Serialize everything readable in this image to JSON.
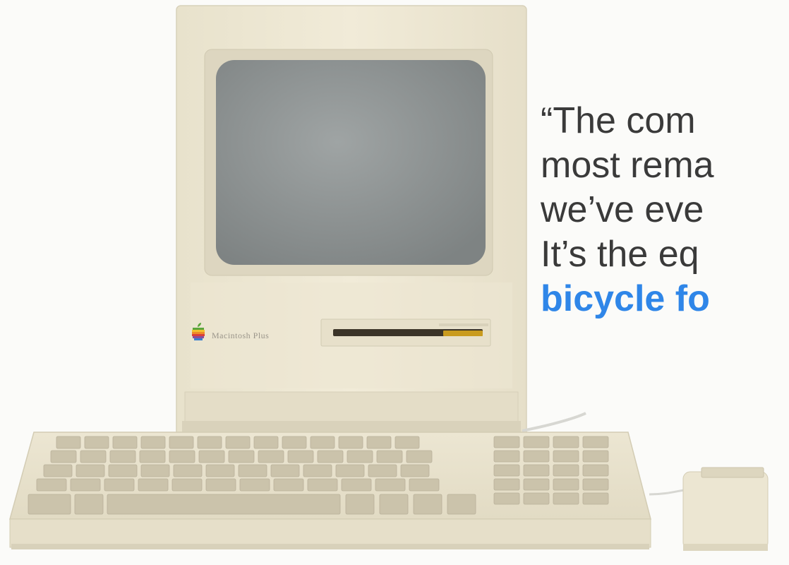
{
  "quote": {
    "line1": "“The com",
    "line2": "most rema",
    "line3": "we’ve eve",
    "line4": "It’s the eq",
    "highlight": "bicycle fo"
  },
  "computer": {
    "model_label": "Macintosh Plus"
  },
  "colors": {
    "background": "#fbfbf9",
    "quote_text": "#3a3a3a",
    "quote_highlight": "#2f86e8",
    "case": "#efe9d6",
    "screen": "#8f9494"
  },
  "icons": [
    "apple-logo-icon"
  ]
}
